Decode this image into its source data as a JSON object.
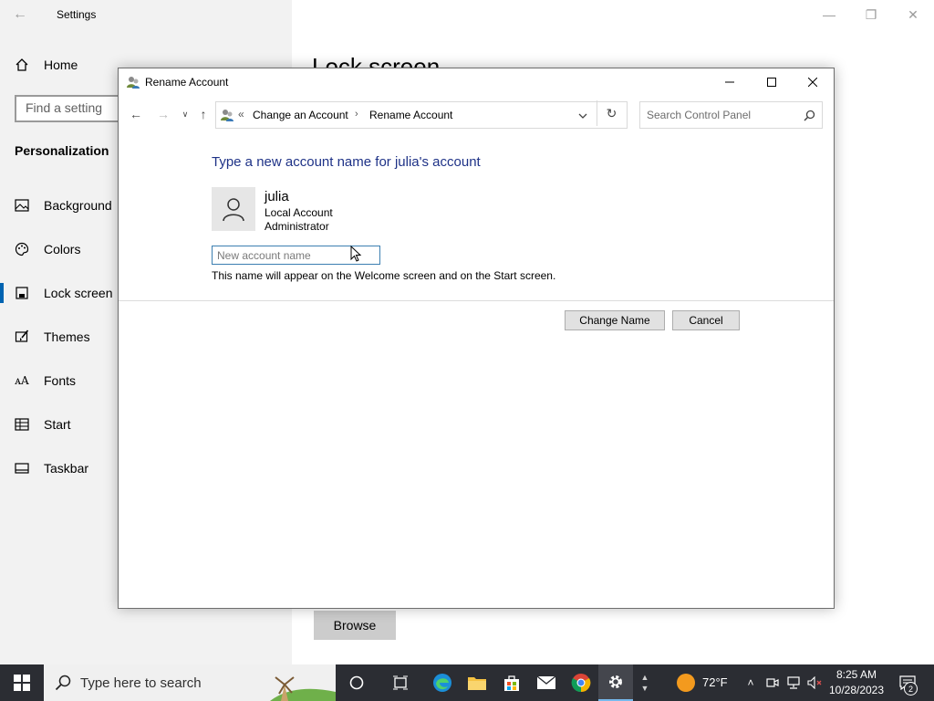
{
  "settings": {
    "title": "Settings",
    "home_label": "Home",
    "search_placeholder": "Find a setting",
    "section": "Personalization",
    "nav": [
      {
        "label": "Background",
        "icon": "picture-icon"
      },
      {
        "label": "Colors",
        "icon": "palette-icon"
      },
      {
        "label": "Lock screen",
        "icon": "lock-screen-icon",
        "active": true
      },
      {
        "label": "Themes",
        "icon": "brush-icon"
      },
      {
        "label": "Fonts",
        "icon": "font-icon"
      },
      {
        "label": "Start",
        "icon": "start-grid-icon"
      },
      {
        "label": "Taskbar",
        "icon": "taskbar-icon"
      }
    ],
    "page_heading": "Lock screen",
    "browse_label": "Browse"
  },
  "dialog": {
    "title": "Rename Account",
    "breadcrumb": [
      "Change an Account",
      "Rename Account"
    ],
    "breadcrumb_prefix": "«",
    "search_placeholder": "Search Control Panel",
    "heading": "Type a new account name for julia's account",
    "account": {
      "name": "julia",
      "type": "Local Account",
      "role": "Administrator"
    },
    "input_placeholder": "New account name",
    "input_value": "",
    "hint": "This name will appear on the Welcome screen and on the Start screen.",
    "change_button": "Change Name",
    "cancel_button": "Cancel"
  },
  "taskbar": {
    "search_placeholder": "Type here to search",
    "temperature": "72°F",
    "time": "8:25 AM",
    "date": "10/28/2023",
    "notification_count": "2",
    "pinned": [
      "cortana-icon",
      "task-view-icon",
      "edge-icon",
      "file-explorer-icon",
      "store-icon",
      "mail-icon",
      "chrome-icon",
      "settings-icon"
    ]
  },
  "colors": {
    "accent": "#0063b1",
    "heading_blue": "#1e3287",
    "taskbar": "#2b2d33"
  }
}
